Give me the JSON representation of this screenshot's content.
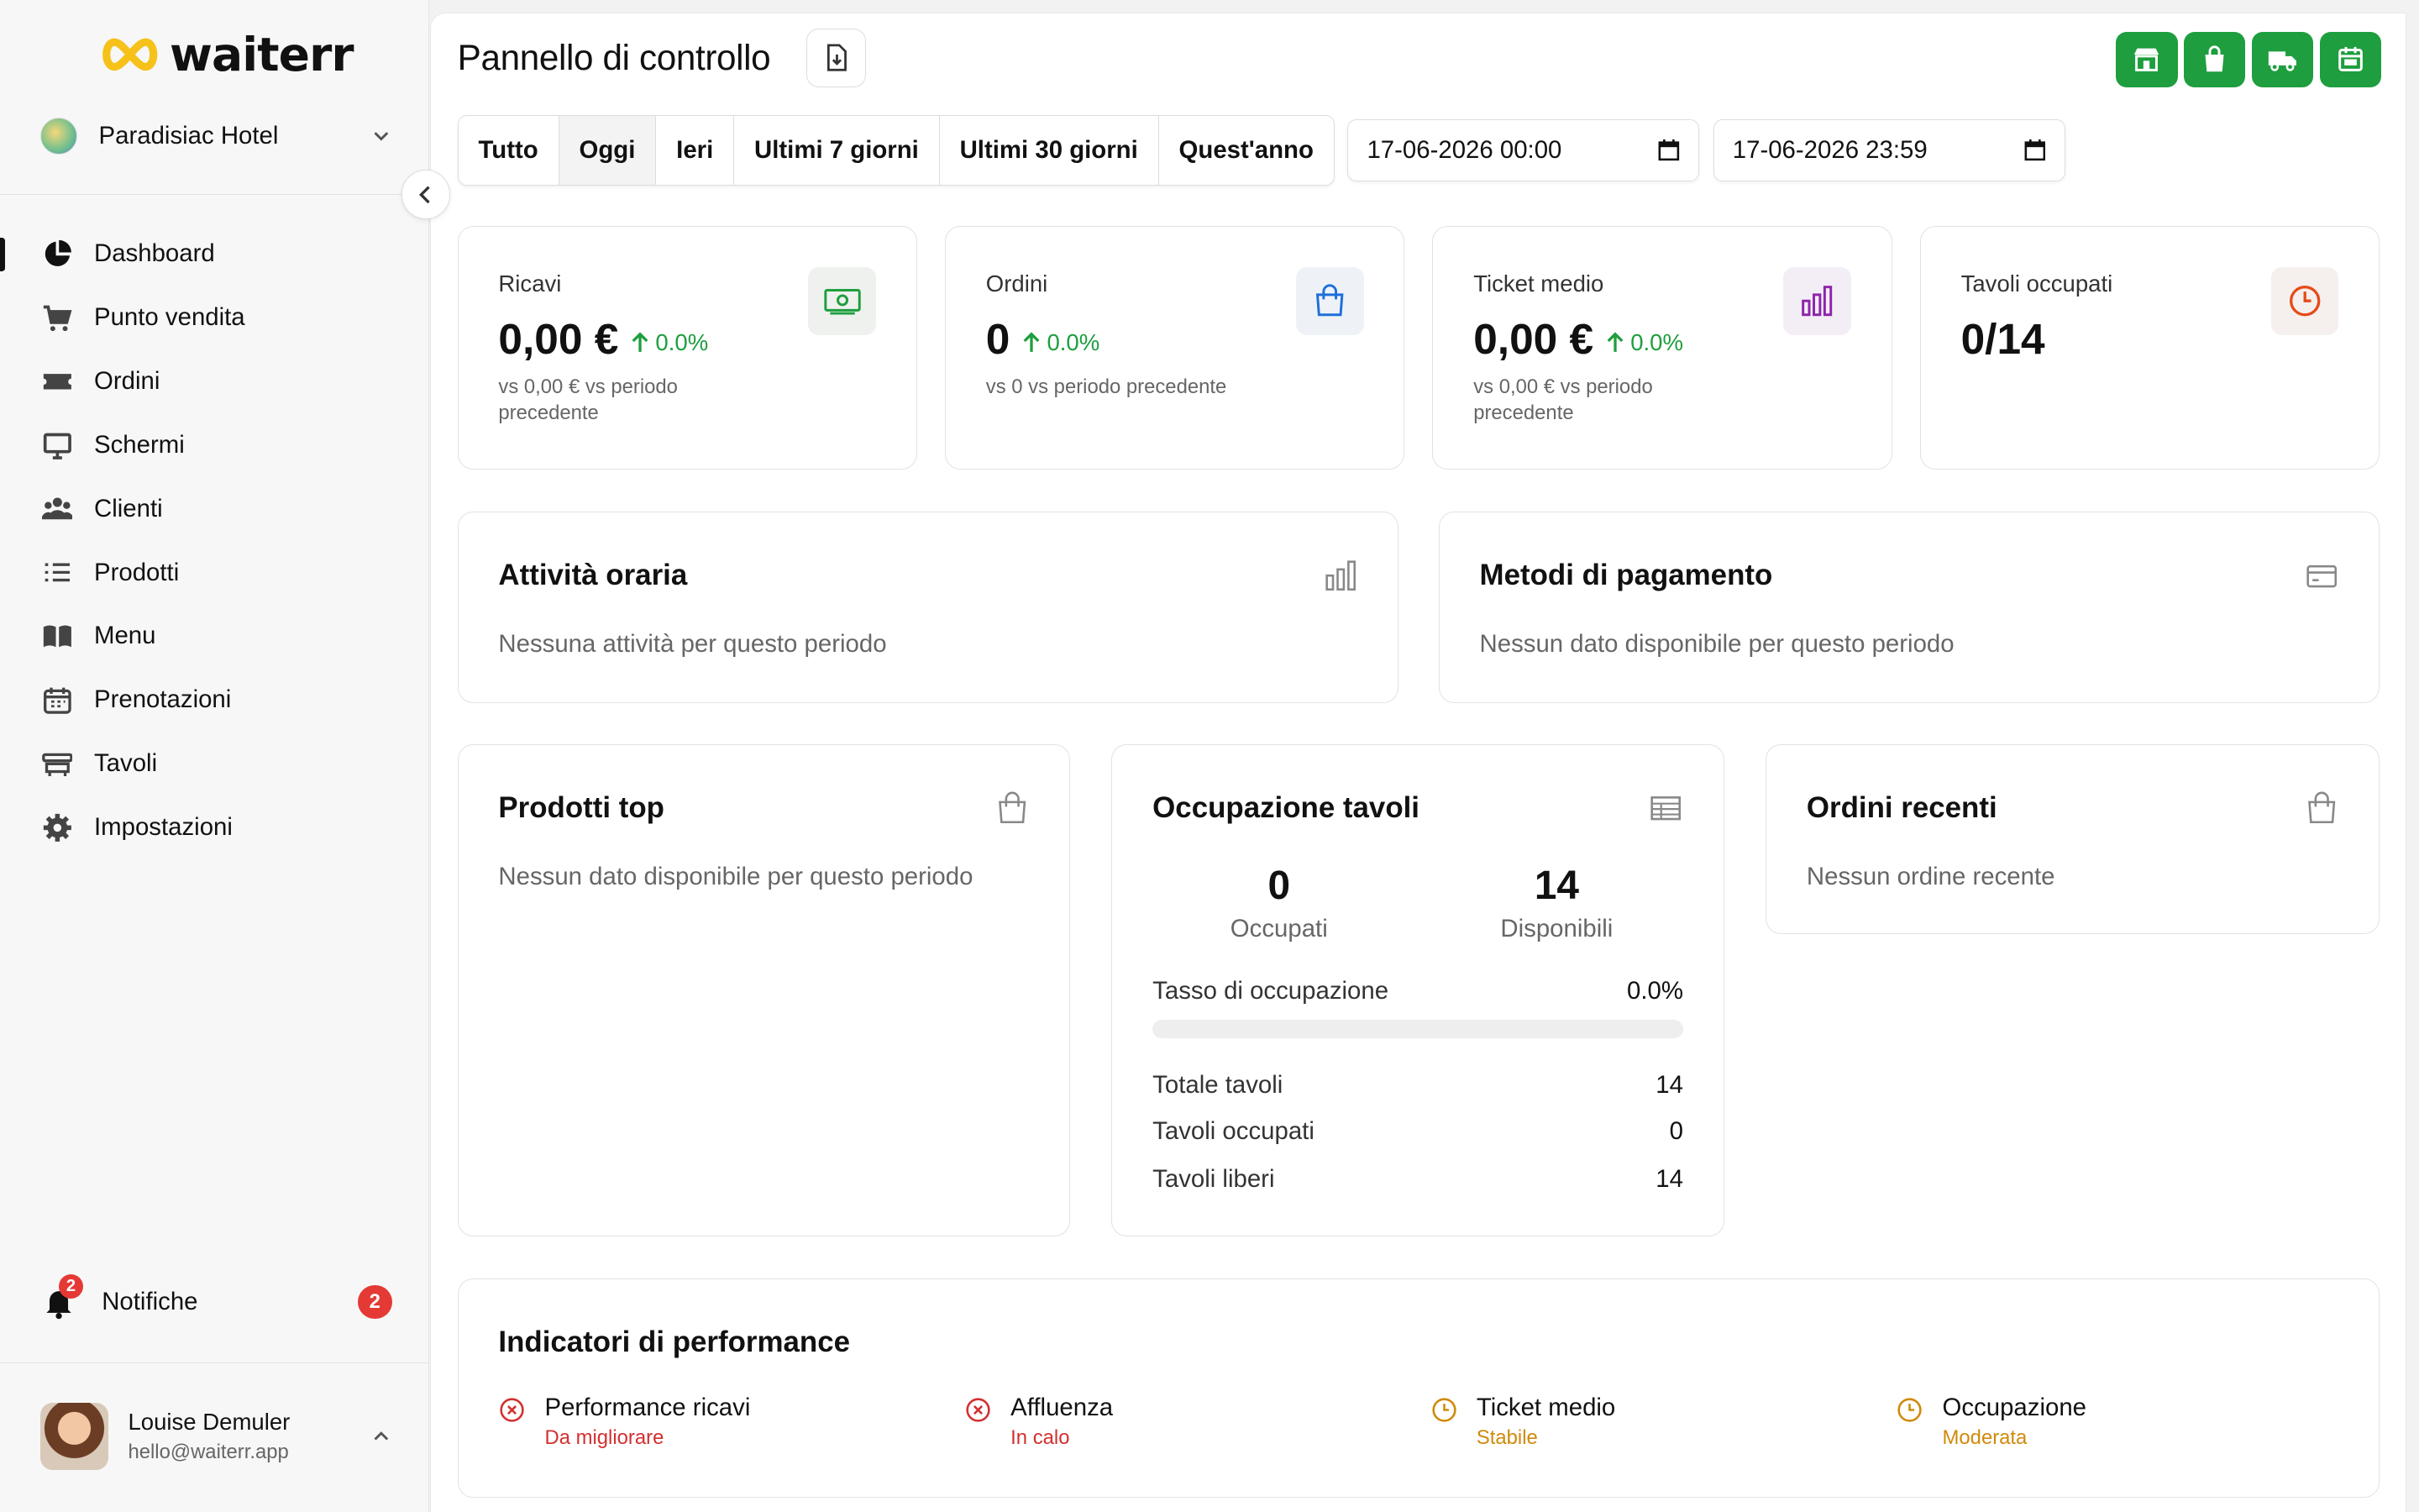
{
  "app": {
    "brand": "waiterr",
    "hotel": "Paradisiac Hotel"
  },
  "sidebar": {
    "items": [
      {
        "label": "Dashboard",
        "icon": "pie-chart-icon",
        "active": true
      },
      {
        "label": "Punto vendita",
        "icon": "cart-icon"
      },
      {
        "label": "Ordini",
        "icon": "ticket-icon"
      },
      {
        "label": "Schermi",
        "icon": "monitor-icon"
      },
      {
        "label": "Clienti",
        "icon": "users-icon"
      },
      {
        "label": "Prodotti",
        "icon": "list-icon"
      },
      {
        "label": "Menu",
        "icon": "book-icon"
      },
      {
        "label": "Prenotazioni",
        "icon": "calendar-icon"
      },
      {
        "label": "Tavoli",
        "icon": "table-icon"
      },
      {
        "label": "Impostazioni",
        "icon": "gear-icon"
      }
    ],
    "notifications": {
      "label": "Notifiche",
      "badge": "2",
      "count": "2"
    },
    "user": {
      "name": "Louise Demuler",
      "email": "hello@waiterr.app"
    }
  },
  "header": {
    "title": "Pannello di controllo"
  },
  "filters": [
    "Tutto",
    "Oggi",
    "Ieri",
    "Ultimi 7 giorni",
    "Ultimi 30 giorni",
    "Quest'anno"
  ],
  "active_filter": "Oggi",
  "dates": {
    "from": "17-06-2026 00:00",
    "to": "17-06-2026 23:59"
  },
  "kpis": [
    {
      "label": "Ricavi",
      "value": "0,00 €",
      "trend": "0.0%",
      "sub": "vs 0,00 € vs periodo precedente",
      "icon": "banknote-icon",
      "color": "#1e9e3e"
    },
    {
      "label": "Ordini",
      "value": "0",
      "trend": "0.0%",
      "sub": "vs 0 vs periodo precedente",
      "icon": "shopping-bag-icon",
      "color": "#1e6fd9"
    },
    {
      "label": "Ticket medio",
      "value": "0,00 €",
      "trend": "0.0%",
      "sub": "vs 0,00 € vs periodo precedente",
      "icon": "bar-chart-icon",
      "color": "#8e24aa"
    },
    {
      "label": "Tavoli occupati",
      "value": "0/14",
      "icon": "clock-icon",
      "color": "#e64a19"
    }
  ],
  "activity": {
    "title": "Attività oraria",
    "empty": "Nessuna attività per questo periodo"
  },
  "payments": {
    "title": "Metodi di pagamento",
    "empty": "Nessun dato disponibile per questo periodo"
  },
  "top_products": {
    "title": "Prodotti top",
    "empty": "Nessun dato disponibile per questo periodo"
  },
  "occupancy": {
    "title": "Occupazione tavoli",
    "occupied": "0",
    "occupied_label": "Occupati",
    "available": "14",
    "available_label": "Disponibili",
    "rate_label": "Tasso di occupazione",
    "rate": "0.0%",
    "rate_value": 0,
    "rows": [
      {
        "label": "Totale tavoli",
        "value": "14"
      },
      {
        "label": "Tavoli occupati",
        "value": "0"
      },
      {
        "label": "Tavoli liberi",
        "value": "14"
      }
    ]
  },
  "recent_orders": {
    "title": "Ordini recenti",
    "empty": "Nessun ordine recente"
  },
  "performance": {
    "title": "Indicatori di performance",
    "items": [
      {
        "name": "Performance ricavi",
        "status": "Da migliorare",
        "color": "#d32f2f",
        "icon": "x-circle-icon"
      },
      {
        "name": "Affluenza",
        "status": "In calo",
        "color": "#d32f2f",
        "icon": "x-circle-icon"
      },
      {
        "name": "Ticket medio",
        "status": "Stabile",
        "color": "#d08a0b",
        "icon": "clock-icon"
      },
      {
        "name": "Occupazione",
        "status": "Moderata",
        "color": "#d08a0b",
        "icon": "clock-icon"
      }
    ]
  },
  "colors": {
    "accent": "#1e9e3e",
    "danger": "#e53935"
  }
}
